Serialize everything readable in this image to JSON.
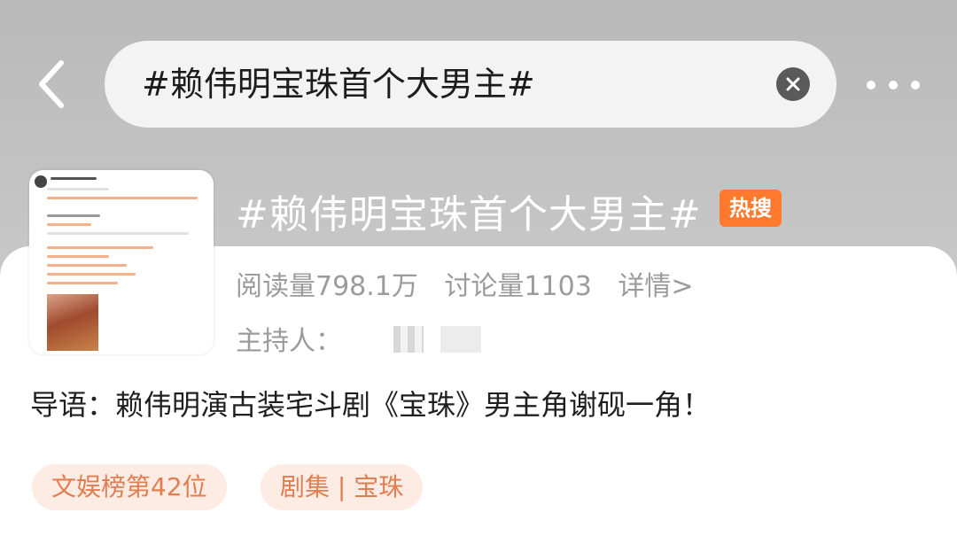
{
  "search": {
    "query": "#赖伟明宝珠首个大男主#"
  },
  "topic": {
    "title": "#赖伟明宝珠首个大男主#",
    "hot_badge": "热搜",
    "reads": "阅读量798.1万",
    "discussions": "讨论量1103",
    "details_link": "详情>",
    "host_label": "主持人：",
    "intro": "导语：赖伟明演古装宅斗剧《宝珠》男主角谢砚一角！"
  },
  "tags": [
    {
      "label": "文娱榜第42位"
    },
    {
      "label": "剧集 | 宝珠"
    }
  ],
  "icons": {
    "back": "chevron-left-icon",
    "clear": "close-circle-icon",
    "more": "more-dots-icon"
  },
  "colors": {
    "hot_badge": "#ff7a2e",
    "tag_text": "#e07e52",
    "tag_bg": "#fdece3"
  }
}
